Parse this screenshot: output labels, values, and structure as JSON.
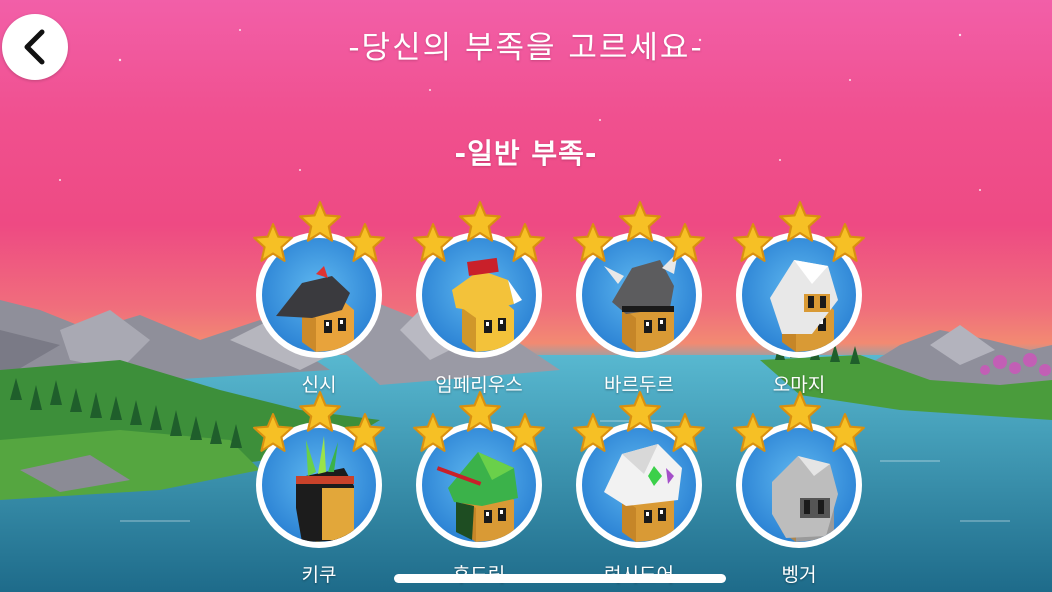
{
  "screen": {
    "title": "-당신의 부족을 고르세요-",
    "section_title": "-일반 부족-"
  },
  "back_button": {
    "icon": "chevron-left-icon"
  },
  "tribes": [
    {
      "label": "신시",
      "icon": "xinxi-tribe-head-icon",
      "stars": 3,
      "hat_color": "#3a3a3e",
      "face_color": "#e8a33b"
    },
    {
      "label": "임페리우스",
      "icon": "imperius-tribe-head-icon",
      "stars": 3,
      "hat_color": "#f3c23a",
      "face_color": "#f3c23a"
    },
    {
      "label": "바르두르",
      "icon": "bardur-tribe-head-icon",
      "stars": 3,
      "hat_color": "#5c5c5e",
      "face_color": "#d99a35"
    },
    {
      "label": "오마지",
      "icon": "oumaji-tribe-head-icon",
      "stars": 3,
      "hat_color": "#e8e8e8",
      "face_color": "#d99a35"
    },
    {
      "label": "키쿠",
      "icon": "kickoo-tribe-head-icon",
      "stars": 3,
      "hat_color": "#1c1c1c",
      "face_color": "#e2a73a"
    },
    {
      "label": "후드릭",
      "icon": "hoodrick-tribe-head-icon",
      "stars": 3,
      "hat_color": "#3bb24a",
      "face_color": "#d99a35"
    },
    {
      "label": "럭시도어",
      "icon": "luxidoor-tribe-head-icon",
      "stars": 3,
      "hat_color": "#f2f2f2",
      "face_color": "#d99a35"
    },
    {
      "label": "벵거",
      "icon": "vengir-tribe-head-icon",
      "stars": 3,
      "hat_color": "#bdbdbd",
      "face_color": "#9a9a9a"
    }
  ],
  "colors": {
    "star_gold": "#f6c025",
    "star_edge": "#d99010",
    "badge_blue": "#2f86d6"
  }
}
